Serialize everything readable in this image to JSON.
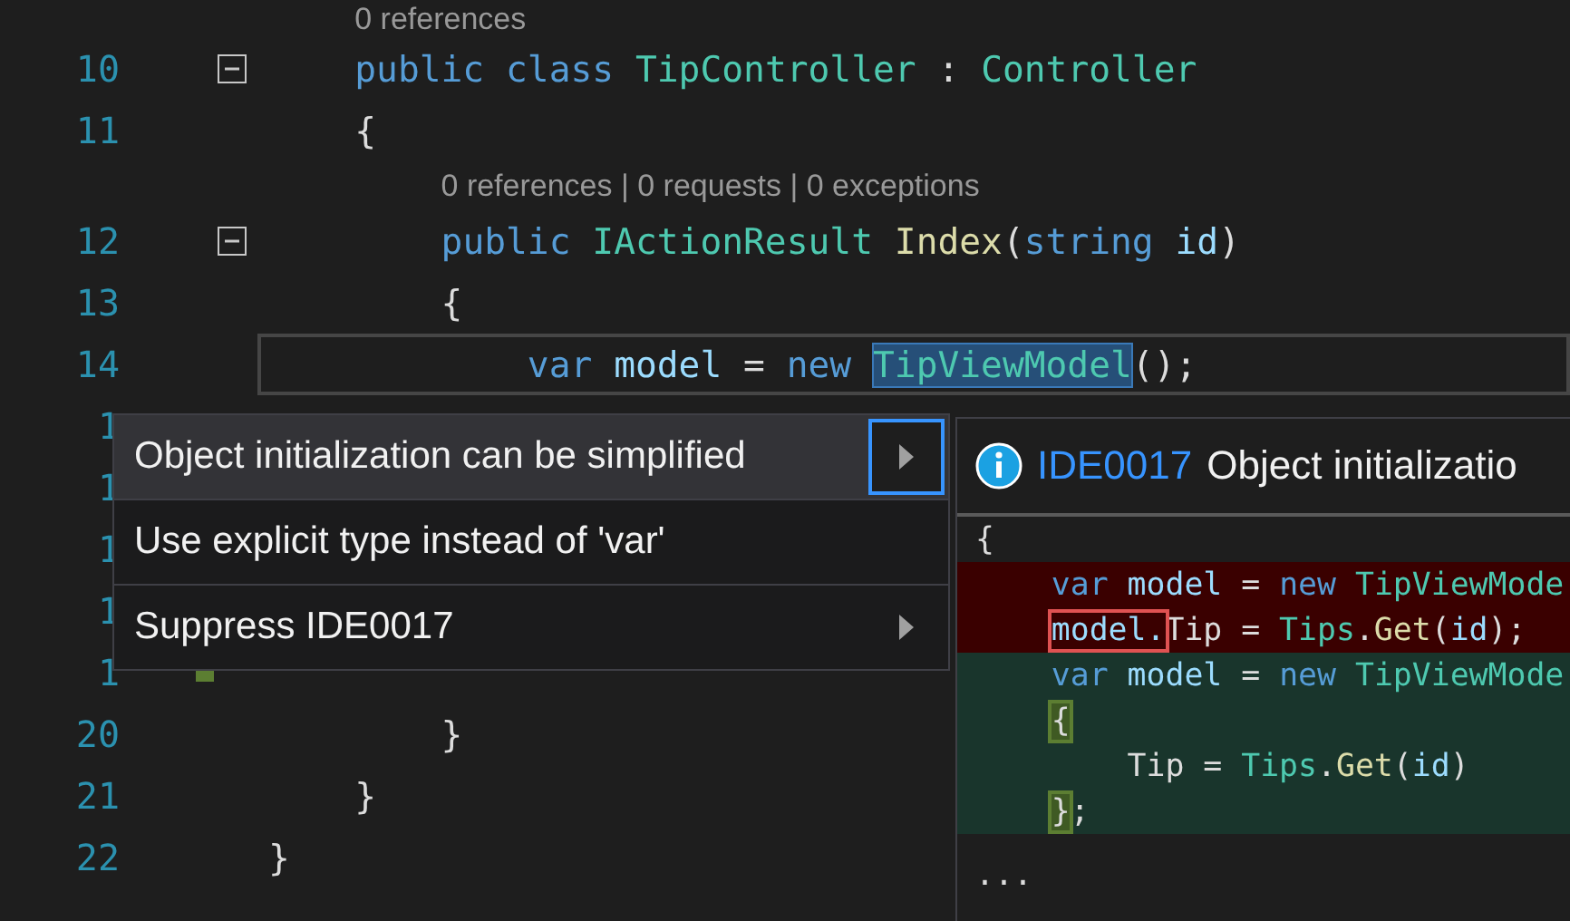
{
  "editor": {
    "lines": [
      {
        "kind": "codelens",
        "text": "0 references"
      },
      {
        "kind": "code",
        "number": "10",
        "fold": true,
        "changed": false,
        "current": false,
        "tokens": [
          {
            "text": "    public ",
            "kind": "keyword"
          },
          {
            "text": "class ",
            "kind": "keyword"
          },
          {
            "text": "TipController",
            "kind": "type"
          },
          {
            "text": " : ",
            "kind": "plain"
          },
          {
            "text": "Controller",
            "kind": "type"
          }
        ]
      },
      {
        "kind": "code",
        "number": "11",
        "fold": false,
        "changed": false,
        "current": false,
        "tokens": [
          {
            "text": "    {",
            "kind": "plain"
          }
        ]
      },
      {
        "kind": "codelens",
        "text": "0 references | 0 requests | 0 exceptions"
      },
      {
        "kind": "code",
        "number": "12",
        "fold": true,
        "changed": false,
        "current": false,
        "tokens": [
          {
            "text": "        public ",
            "kind": "keyword"
          },
          {
            "text": "IActionResult",
            "kind": "type"
          },
          {
            "text": " Index",
            "kind": "method"
          },
          {
            "text": "(",
            "kind": "plain"
          },
          {
            "text": "string ",
            "kind": "keyword"
          },
          {
            "text": "id",
            "kind": "variable"
          },
          {
            "text": ")",
            "kind": "plain"
          }
        ]
      },
      {
        "kind": "code",
        "number": "13",
        "fold": false,
        "changed": false,
        "current": false,
        "tokens": [
          {
            "text": "        {",
            "kind": "plain"
          }
        ]
      },
      {
        "kind": "code",
        "number": "14",
        "fold": false,
        "changed": false,
        "current": true,
        "tokens": [
          {
            "text": "            var ",
            "kind": "keyword"
          },
          {
            "text": "model",
            "kind": "variable"
          },
          {
            "text": " = ",
            "kind": "plain"
          },
          {
            "text": "new ",
            "kind": "keyword"
          },
          {
            "text": "TipViewModel",
            "kind": "type-selected"
          },
          {
            "text": "();",
            "kind": "plain"
          }
        ]
      },
      {
        "kind": "code",
        "number": "1",
        "current": false
      },
      {
        "kind": "code",
        "number": "1",
        "current": false
      },
      {
        "kind": "code",
        "number": "1",
        "current": false
      },
      {
        "kind": "code",
        "number": "1",
        "current": false
      },
      {
        "kind": "code",
        "number": "1",
        "changed": true,
        "current": false
      },
      {
        "kind": "code",
        "number": "20",
        "fold": false,
        "changed": false,
        "current": false,
        "tokens": [
          {
            "text": "        }",
            "kind": "plain"
          }
        ]
      },
      {
        "kind": "code",
        "number": "21",
        "fold": false,
        "changed": false,
        "current": false,
        "tokens": [
          {
            "text": "    }",
            "kind": "plain"
          }
        ]
      },
      {
        "kind": "code",
        "number": "22",
        "fold": false,
        "changed": false,
        "current": false,
        "tokens": [
          {
            "text": "}",
            "kind": "plain"
          }
        ]
      }
    ]
  },
  "menu": {
    "items": [
      {
        "label": "Object initialization can be simplified",
        "selected": true,
        "submenu": true
      },
      {
        "label": "Use explicit type instead of 'var'",
        "selected": false,
        "submenu": false
      },
      {
        "label": "Suppress IDE0017",
        "selected": false,
        "submenu": true
      }
    ]
  },
  "preview": {
    "code_id": "IDE0017",
    "title": "Object initializatio",
    "lines": [
      {
        "removed": false,
        "added": false,
        "tokens": [
          {
            "text": "{",
            "kind": "plain"
          }
        ]
      },
      {
        "removed": true,
        "added": false,
        "tokens": [
          {
            "text": "    var ",
            "kind": "keyword"
          },
          {
            "text": "model",
            "kind": "variable"
          },
          {
            "text": " = ",
            "kind": "plain"
          },
          {
            "text": "new ",
            "kind": "keyword"
          },
          {
            "text": "TipViewMode",
            "kind": "type"
          }
        ]
      },
      {
        "removed": true,
        "added": false,
        "tokens": [
          {
            "text": "    model.",
            "kind": "removed-mark"
          },
          {
            "text": "Tip = ",
            "kind": "plain"
          },
          {
            "text": "Tips",
            "kind": "type"
          },
          {
            "text": ".",
            "kind": "plain"
          },
          {
            "text": "Get",
            "kind": "method"
          },
          {
            "text": "(",
            "kind": "plain"
          },
          {
            "text": "id",
            "kind": "variable"
          },
          {
            "text": ");",
            "kind": "plain"
          }
        ]
      },
      {
        "removed": false,
        "added": true,
        "tokens": [
          {
            "text": "    var ",
            "kind": "keyword"
          },
          {
            "text": "model",
            "kind": "variable"
          },
          {
            "text": " = ",
            "kind": "plain"
          },
          {
            "text": "new ",
            "kind": "keyword"
          },
          {
            "text": "TipViewMode",
            "kind": "type"
          }
        ]
      },
      {
        "removed": false,
        "added": true,
        "tokens": [
          {
            "text": "    {",
            "kind": "added-mark"
          }
        ]
      },
      {
        "removed": false,
        "added": true,
        "tokens": [
          {
            "text": "        Tip = ",
            "kind": "plain"
          },
          {
            "text": "Tips",
            "kind": "type"
          },
          {
            "text": ".",
            "kind": "plain"
          },
          {
            "text": "Get",
            "kind": "method"
          },
          {
            "text": "(",
            "kind": "plain"
          },
          {
            "text": "id",
            "kind": "variable"
          },
          {
            "text": ")",
            "kind": "plain"
          }
        ]
      },
      {
        "removed": false,
        "added": true,
        "tokens": [
          {
            "text": "    }",
            "kind": "added-mark"
          },
          {
            "text": ";",
            "kind": "plain"
          }
        ]
      },
      {
        "removed": false,
        "added": false,
        "tokens": [
          {
            "text": "...",
            "kind": "plain"
          }
        ]
      }
    ]
  }
}
